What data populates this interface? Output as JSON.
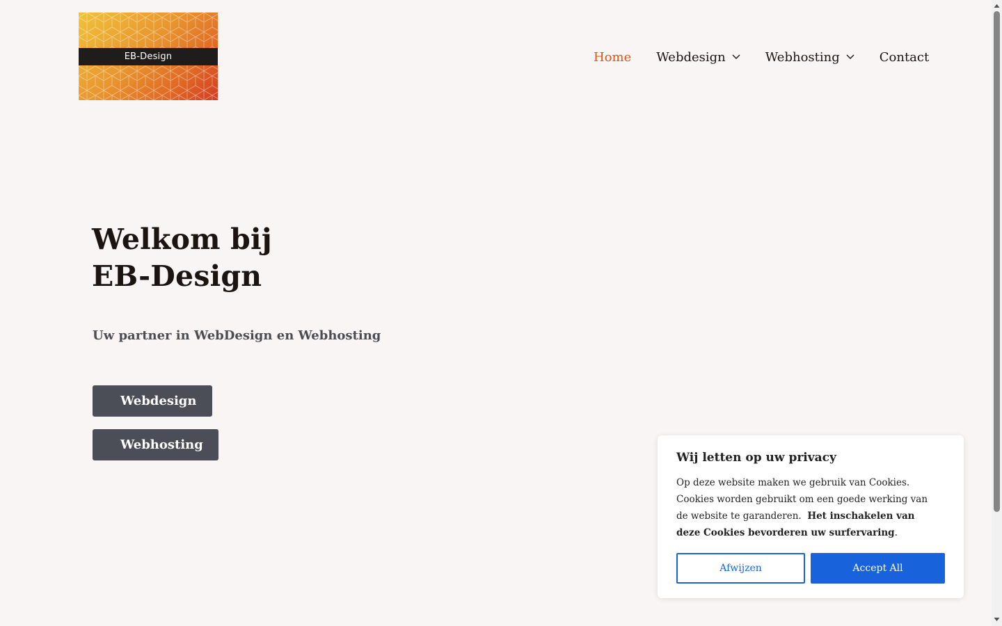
{
  "header": {
    "logo_text": "EB-Design",
    "nav": [
      {
        "label": "Home",
        "active": true,
        "has_dropdown": false
      },
      {
        "label": "Webdesign",
        "active": false,
        "has_dropdown": true
      },
      {
        "label": "Webhosting",
        "active": false,
        "has_dropdown": true
      },
      {
        "label": "Contact",
        "active": false,
        "has_dropdown": false
      }
    ]
  },
  "hero": {
    "title_line1": "Welkom bij",
    "title_line2": "EB-Design",
    "subtitle": "Uw partner in WebDesign en Webhosting",
    "buttons": [
      "Webdesign",
      "Webhosting"
    ]
  },
  "cookie": {
    "title": "Wij letten op uw privacy",
    "text": "Op deze website maken we gebruik van Cookies. Cookies worden gebruikt om een goede werking van de website te garanderen.",
    "bold_text": "Het inschakelen van deze Cookies bevorderen uw surfervaring",
    "end_punct": ".",
    "reject_label": "Afwijzen",
    "accept_label": "Accept All"
  },
  "colors": {
    "accent": "#e0530e",
    "button_dark": "#4b4e56",
    "cookie_blue": "#1863dc",
    "background": "#f8f5f4"
  },
  "icons": [
    "chevron-down-icon",
    "scroll-up-icon",
    "scroll-down-icon"
  ]
}
